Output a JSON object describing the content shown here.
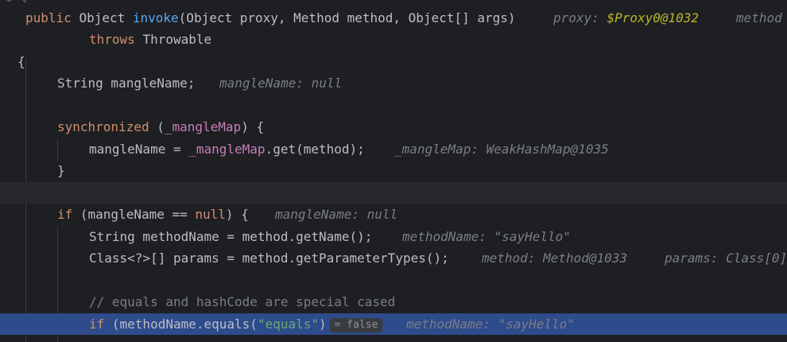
{
  "editor": {
    "gutter_fold_glyph": "⌄",
    "lines": {
      "l1": {
        "public": "public",
        "object_type": "Object",
        "method": "invoke",
        "params": "(Object proxy, Method method, Object[] args)",
        "hint1_name": "proxy: ",
        "hint1_value": "$Proxy0@1032",
        "hint2_name": "method"
      },
      "l2": {
        "throws": "throws",
        "rest": "Throwable"
      },
      "l3": {
        "brace": "{"
      },
      "l4": {
        "code": "String mangleName;",
        "hint": "mangleName: null"
      },
      "l6": {
        "kw": "synchronized",
        "open": " (",
        "field": "_mangleMap",
        "close": ") {"
      },
      "l7": {
        "pre": "mangleName = ",
        "field": "_mangleMap",
        "post": ".get(method);",
        "hint": "_mangleMap: WeakHashMap@1035"
      },
      "l8": {
        "brace": "}"
      },
      "l10": {
        "kw": "if",
        "mid": " (mangleName == ",
        "null": "null",
        "end": ") {",
        "hint": "mangleName: null"
      },
      "l11": {
        "code": "String methodName = method.getName();",
        "hint": "methodName: \"sayHello\""
      },
      "l12": {
        "code": "Class<?>[] params = method.getParameterTypes();",
        "hint1": "method: Method@1033",
        "hint2": "params: Class[0]"
      },
      "l14": {
        "comment": "// equals and hashCode are special cased"
      },
      "l15": {
        "kw": "if",
        "pre": " (methodName.equals(",
        "str": "\"equals\"",
        "post": ")",
        "badge": "= false",
        "hint": "methodName: \"sayHello\""
      }
    }
  }
}
